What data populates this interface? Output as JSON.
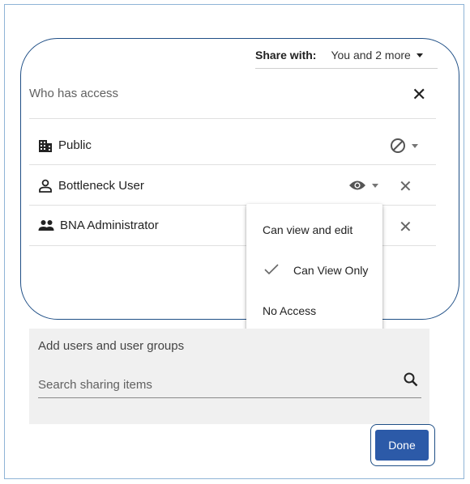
{
  "share": {
    "label": "Share with:",
    "value": "You and 2 more"
  },
  "access": {
    "title": "Who has access",
    "rows": [
      {
        "label": "Public",
        "icon": "building-icon",
        "permission_icon": "no-access-icon"
      },
      {
        "label": "Bottleneck User",
        "icon": "user-icon",
        "permission_icon": "eye-icon"
      },
      {
        "label": "BNA Administrator",
        "icon": "user-group-icon"
      }
    ]
  },
  "permission_menu": {
    "items": [
      {
        "label": "Can view and edit",
        "selected": false
      },
      {
        "label": "Can View Only",
        "selected": true
      },
      {
        "label": "No Access",
        "selected": false
      }
    ]
  },
  "add_users": {
    "title": "Add users and user groups",
    "search_placeholder": "Search sharing items"
  },
  "done_label": "Done",
  "colors": {
    "primary": "#2c5aa8",
    "outline": "#1f4f86",
    "panel": "#f0f0f0"
  }
}
